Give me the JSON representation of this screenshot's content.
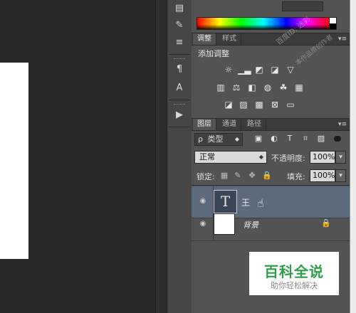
{
  "adjustments_panel": {
    "tabs": [
      {
        "label": "调整",
        "active": true
      },
      {
        "label": "样式",
        "active": false
      }
    ],
    "title": "添加调整",
    "rows": [
      [
        "brightness-contrast-icon",
        "levels-icon",
        "curves-icon",
        "exposure-icon",
        "vibrance-icon"
      ],
      [
        "hue-saturation-icon",
        "color-balance-icon",
        "black-white-icon",
        "photo-filter-icon",
        "channel-mixer-icon",
        "color-lookup-icon"
      ],
      [
        "invert-icon",
        "posterize-icon",
        "threshold-icon",
        "selective-color-icon",
        "gradient-map-icon"
      ]
    ]
  },
  "layers_panel": {
    "tabs": [
      {
        "label": "图层",
        "active": true
      },
      {
        "label": "通道",
        "active": false
      },
      {
        "label": "路径",
        "active": false
      }
    ],
    "filter": {
      "search_glyph": "ρ",
      "kind_label": "类型",
      "icons": [
        "image-filter-icon",
        "adjustment-filter-icon",
        "type-filter-icon",
        "shape-filter-icon",
        "smart-object-filter-icon"
      ]
    },
    "blend_mode": "正常",
    "opacity_label": "不透明度:",
    "opacity_value": "100%",
    "lock_label": "锁定:",
    "fill_label": "填充:",
    "fill_value": "100%",
    "layers": [
      {
        "name": "王",
        "thumb_glyph": "T",
        "visible": true,
        "selected": true
      },
      {
        "name": "背景",
        "visible": true,
        "selected": false,
        "locked": true
      }
    ]
  },
  "watermark": {
    "title": "百科全说",
    "subtitle": "助你轻松解决",
    "diagonal": "百度ID: 迷彩",
    "diagonal2": "本作品原创作者"
  },
  "colors": {
    "panel_bg": "#535353",
    "selected_layer": "#5c6a7e",
    "watermark_green": "#2e9e4a"
  }
}
